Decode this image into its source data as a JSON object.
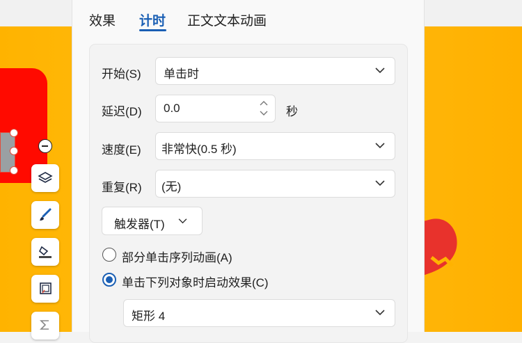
{
  "tabs": [
    {
      "label": "效果"
    },
    {
      "label": "计时",
      "active": true
    },
    {
      "label": "正文文本动画"
    }
  ],
  "timing": {
    "start": {
      "label": "开始(S)",
      "value": "单击时"
    },
    "delay": {
      "label": "延迟(D)",
      "value": "0.0",
      "unit": "秒"
    },
    "speed": {
      "label": "速度(E)",
      "value": "非常快(0.5 秒)"
    },
    "repeat": {
      "label": "重复(R)",
      "value": "(无)"
    },
    "trigger_button": "触发器(T)",
    "options": [
      {
        "label": "部分单击序列动画(A)",
        "selected": false
      },
      {
        "label": "单击下列对象时启动效果(C)",
        "selected": true
      }
    ],
    "object": {
      "value": "矩形 4"
    }
  },
  "colors": {
    "accent": "#1a5fb4",
    "slide_background": "#ffb300",
    "red_shape": "#ff0a00"
  },
  "toolbar_icons": [
    "layers-icon",
    "brush-icon",
    "fill-icon",
    "crop-icon",
    "formula-icon"
  ]
}
